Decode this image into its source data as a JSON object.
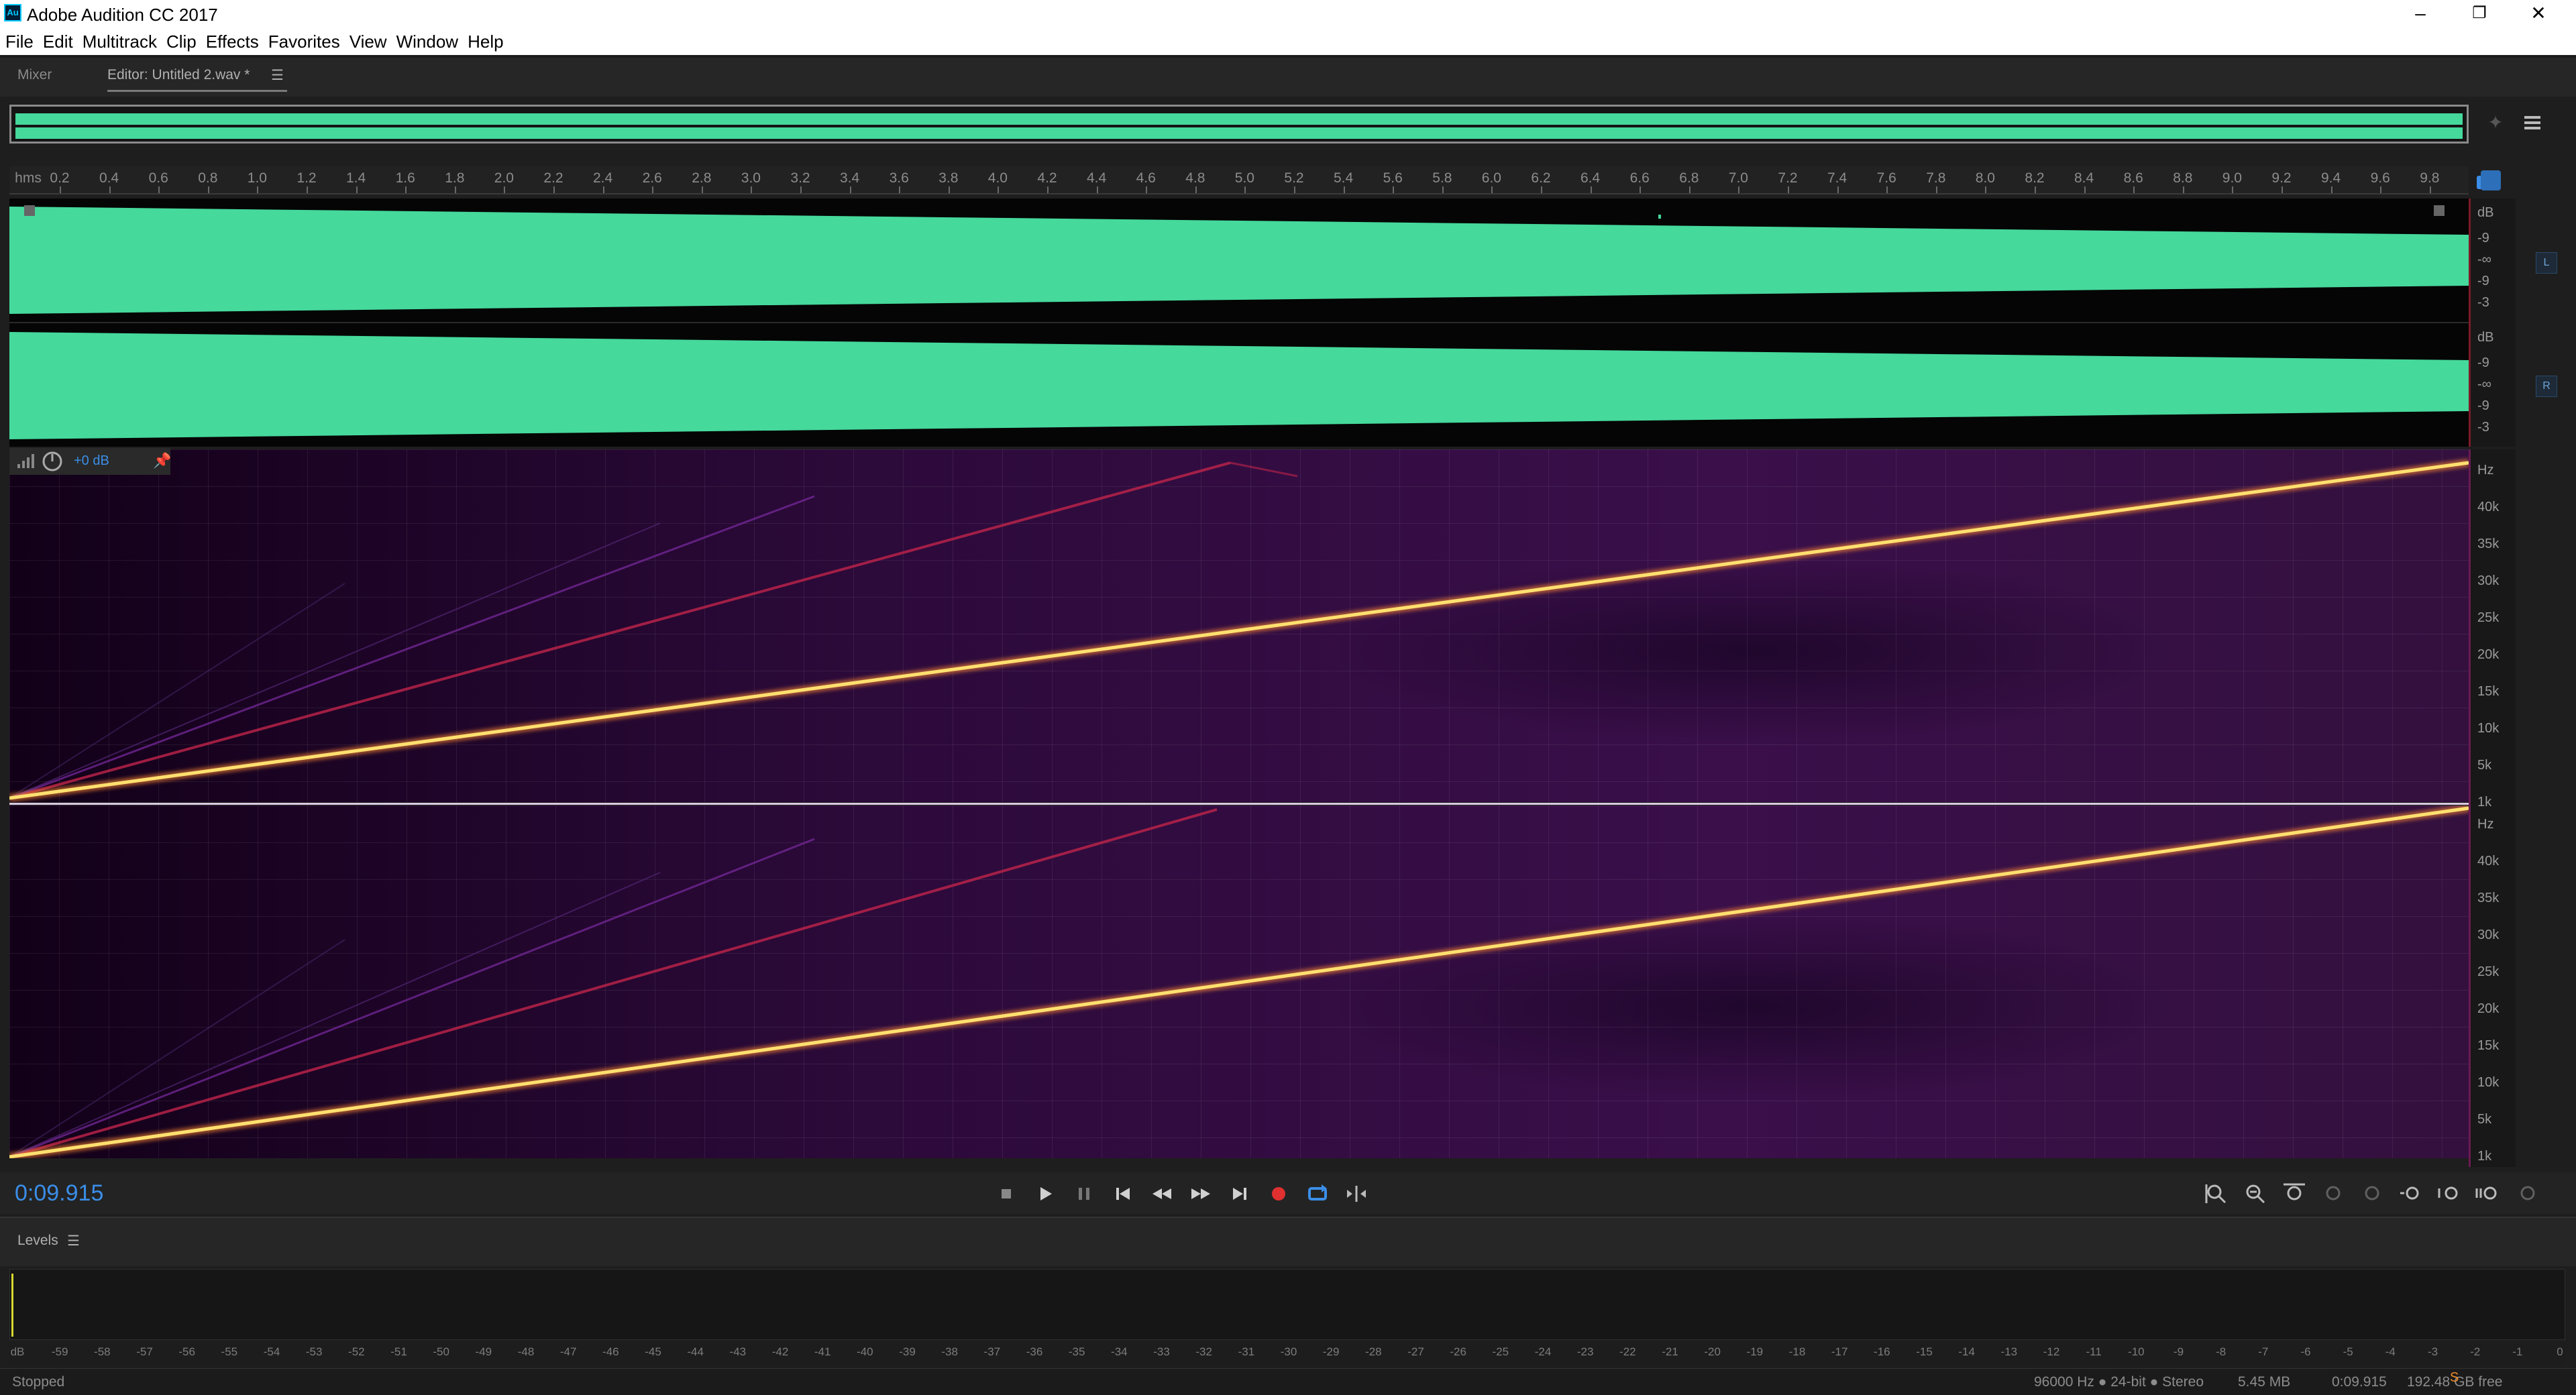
{
  "window": {
    "app_icon_text": "Au",
    "title": "Adobe Audition CC 2017",
    "minimize": "–",
    "restore": "❐",
    "close": "✕"
  },
  "menu": [
    "File",
    "Edit",
    "Multitrack",
    "Clip",
    "Effects",
    "Favorites",
    "View",
    "Window",
    "Help"
  ],
  "tabs": {
    "mixer": "Mixer",
    "editor": "Editor: Untitled 2.wav *",
    "menu_icon": "☰"
  },
  "ruler": {
    "unit": "hms",
    "ticks": [
      "0.2",
      "0.4",
      "0.6",
      "0.8",
      "1.0",
      "1.2",
      "1.4",
      "1.6",
      "1.8",
      "2.0",
      "2.2",
      "2.4",
      "2.6",
      "2.8",
      "3.0",
      "3.2",
      "3.4",
      "3.6",
      "3.8",
      "4.0",
      "4.2",
      "4.4",
      "4.6",
      "4.8",
      "5.0",
      "5.2",
      "5.4",
      "5.6",
      "5.8",
      "6.0",
      "6.2",
      "6.4",
      "6.6",
      "6.8",
      "7.0",
      "7.2",
      "7.4",
      "7.6",
      "7.8",
      "8.0",
      "8.2",
      "8.4",
      "8.6",
      "8.8",
      "9.0",
      "9.2",
      "9.4",
      "9.6",
      "9.8"
    ]
  },
  "waveform_scale": [
    "dB",
    "-9",
    "-∞",
    "-9",
    "-3"
  ],
  "channels": {
    "left": "L",
    "right": "R"
  },
  "spectral": {
    "gain": "+0 dB",
    "scale": [
      "Hz",
      "40k",
      "35k",
      "30k",
      "25k",
      "20k",
      "15k",
      "10k",
      "5k",
      "1k"
    ]
  },
  "colors": {
    "waveform": "#45d99b",
    "accent": "#3b8ee8",
    "record": "#e03030",
    "sweep": "#ffd24a"
  },
  "transport": {
    "time": "0:09.915"
  },
  "levels": {
    "title": "Levels",
    "menu_icon": "☰",
    "scale": [
      "dB",
      "-59",
      "-58",
      "-57",
      "-56",
      "-55",
      "-54",
      "-53",
      "-52",
      "-51",
      "-50",
      "-49",
      "-48",
      "-47",
      "-46",
      "-45",
      "-44",
      "-43",
      "-42",
      "-41",
      "-40",
      "-39",
      "-38",
      "-37",
      "-36",
      "-35",
      "-34",
      "-33",
      "-32",
      "-31",
      "-30",
      "-29",
      "-28",
      "-27",
      "-26",
      "-25",
      "-24",
      "-23",
      "-22",
      "-21",
      "-20",
      "-19",
      "-18",
      "-17",
      "-16",
      "-15",
      "-14",
      "-13",
      "-12",
      "-11",
      "-10",
      "-9",
      "-8",
      "-7",
      "-6",
      "-5",
      "-4",
      "-3",
      "-2",
      "-1",
      "0"
    ]
  },
  "status": {
    "state": "Stopped",
    "format": "96000 Hz ● 24-bit ● Stereo",
    "size": "5.45 MB",
    "duration": "0:09.915",
    "free": "192.48 GB free"
  }
}
